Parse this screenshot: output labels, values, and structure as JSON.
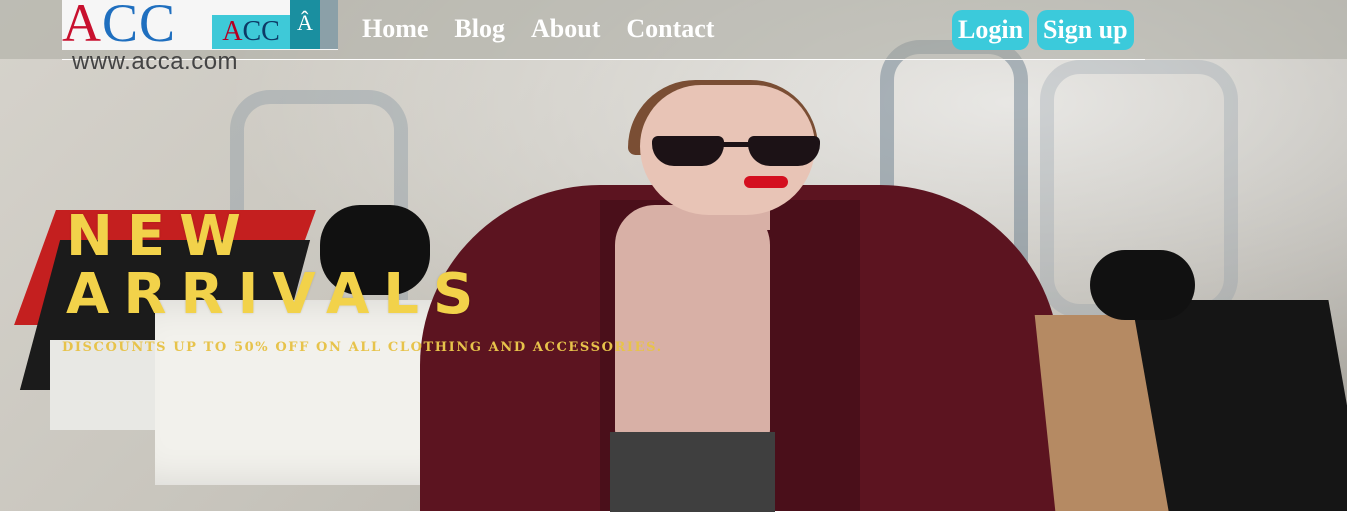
{
  "page_title": "ACCA",
  "logo": {
    "main_text_first": "A",
    "main_text_rest": "CC",
    "mini_first": "A",
    "mini_rest": "CC",
    "mark_glyph": "Â",
    "url": "www.acca.com"
  },
  "nav": {
    "items": [
      {
        "label": "Home"
      },
      {
        "label": "Blog"
      },
      {
        "label": "About"
      },
      {
        "label": "Contact"
      }
    ]
  },
  "auth": {
    "login_label": "Login",
    "signup_label": "Sign up"
  },
  "hero": {
    "title_line1": "NEW",
    "title_line2": "ARRIVALS",
    "subtitle": "DISCOUNTS UP TO 50% OFF ON ALL CLOTHING AND ACCESSORIES."
  },
  "colors": {
    "accent": "#3bcadb",
    "hero_text": "#f2d24a",
    "brand_red": "#c8102e"
  }
}
